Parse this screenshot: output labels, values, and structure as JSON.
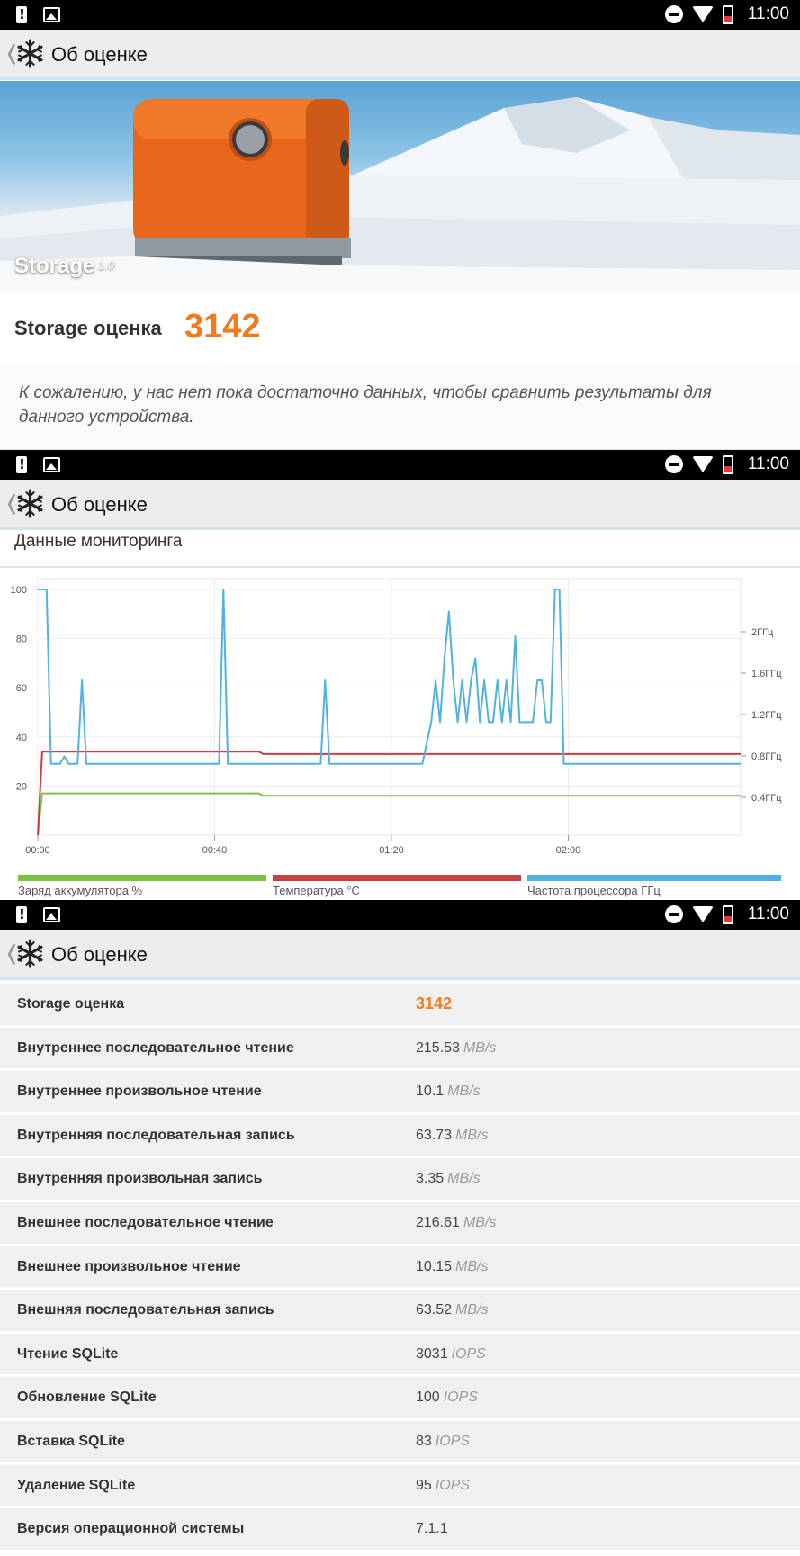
{
  "status_bar": {
    "time": "11:00"
  },
  "app_bar": {
    "title": "Об оценке"
  },
  "hero": {
    "name": "Storage",
    "version": "1.0"
  },
  "score": {
    "label": "Storage оценка",
    "value": "3142"
  },
  "notice": "К сожалению, у нас нет пока достаточно данных, чтобы сравнить результаты для данного устройства.",
  "monitoring": {
    "title": "Данные мониторинга",
    "legend": {
      "battery": "Заряд аккумулятора %",
      "temperature": "Температура °C",
      "cpu": "Частота процессора ГГц"
    },
    "colors": {
      "battery": "#7dc143",
      "temperature": "#c94042",
      "cpu": "#4fb3e1"
    }
  },
  "chart_data": {
    "type": "line",
    "x_ticks": [
      "00:00",
      "00:40",
      "01:20",
      "02:00"
    ],
    "x_tick_minutes": [
      0,
      40,
      80,
      120
    ],
    "x_range_minutes": [
      0,
      159
    ],
    "y_left_ticks": [
      "20",
      "40",
      "60",
      "80",
      "100"
    ],
    "y_left_range": [
      0,
      100
    ],
    "y_right_ticks": [
      "0.4ГГц",
      "0.8ГГц",
      "1.2ГГц",
      "1.6ГГц",
      "2ГГц"
    ],
    "series": [
      {
        "name": "Заряд аккумулятора %",
        "color": "#7dc143",
        "points": [
          [
            0,
            0
          ],
          [
            1,
            17
          ],
          [
            50,
            17
          ],
          [
            51,
            16
          ],
          [
            159,
            16
          ]
        ]
      },
      {
        "name": "Температура °C",
        "color": "#c94042",
        "points": [
          [
            0,
            0
          ],
          [
            1,
            34
          ],
          [
            50,
            34
          ],
          [
            51,
            33
          ],
          [
            159,
            33
          ]
        ]
      },
      {
        "name": "Частота процессора ГГц",
        "color": "#4fb3e1",
        "points": [
          [
            0,
            100
          ],
          [
            2,
            100
          ],
          [
            3,
            29
          ],
          [
            5,
            29
          ],
          [
            6,
            32
          ],
          [
            7,
            29
          ],
          [
            9,
            29
          ],
          [
            10,
            63
          ],
          [
            11,
            29
          ],
          [
            20,
            29
          ],
          [
            30,
            29
          ],
          [
            41,
            29
          ],
          [
            42,
            100
          ],
          [
            43,
            29
          ],
          [
            55,
            29
          ],
          [
            64,
            29
          ],
          [
            65,
            63
          ],
          [
            66,
            29
          ],
          [
            77,
            29
          ],
          [
            87,
            29
          ],
          [
            89,
            46
          ],
          [
            90,
            63
          ],
          [
            91,
            46
          ],
          [
            92,
            72
          ],
          [
            93,
            91
          ],
          [
            94,
            63
          ],
          [
            95,
            46
          ],
          [
            96,
            63
          ],
          [
            97,
            46
          ],
          [
            98,
            63
          ],
          [
            99,
            72
          ],
          [
            100,
            46
          ],
          [
            101,
            63
          ],
          [
            102,
            46
          ],
          [
            103,
            46
          ],
          [
            104,
            63
          ],
          [
            105,
            46
          ],
          [
            106,
            63
          ],
          [
            107,
            46
          ],
          [
            108,
            81
          ],
          [
            109,
            46
          ],
          [
            110,
            46
          ],
          [
            111,
            46
          ],
          [
            112,
            46
          ],
          [
            113,
            63
          ],
          [
            114,
            63
          ],
          [
            115,
            46
          ],
          [
            116,
            46
          ],
          [
            117,
            100
          ],
          [
            118,
            100
          ],
          [
            119,
            29
          ],
          [
            140,
            29
          ],
          [
            159,
            29
          ]
        ]
      }
    ]
  },
  "details": [
    {
      "label": "Storage оценка",
      "value": "3142",
      "unit": "",
      "is_score": true
    },
    {
      "label": "Внутреннее последовательное чтение",
      "value": "215.53",
      "unit": "MB/s"
    },
    {
      "label": "Внутреннее произвольное чтение",
      "value": "10.1",
      "unit": "MB/s"
    },
    {
      "label": "Внутренняя последовательная запись",
      "value": "63.73",
      "unit": "MB/s"
    },
    {
      "label": "Внутренняя произвольная запись",
      "value": "3.35",
      "unit": "MB/s"
    },
    {
      "label": "Внешнее последовательное чтение",
      "value": "216.61",
      "unit": "MB/s"
    },
    {
      "label": "Внешнее произвольное чтение",
      "value": "10.15",
      "unit": "MB/s"
    },
    {
      "label": "Внешняя последовательная запись",
      "value": "63.52",
      "unit": "MB/s"
    },
    {
      "label": "Чтение SQLite",
      "value": "3031",
      "unit": "IOPS"
    },
    {
      "label": "Обновление SQLite",
      "value": "100",
      "unit": "IOPS"
    },
    {
      "label": "Вставка SQLite",
      "value": "83",
      "unit": "IOPS"
    },
    {
      "label": "Удаление SQLite",
      "value": "95",
      "unit": "IOPS"
    },
    {
      "label": "Версия операционной системы",
      "value": "7.1.1",
      "unit": ""
    }
  ]
}
